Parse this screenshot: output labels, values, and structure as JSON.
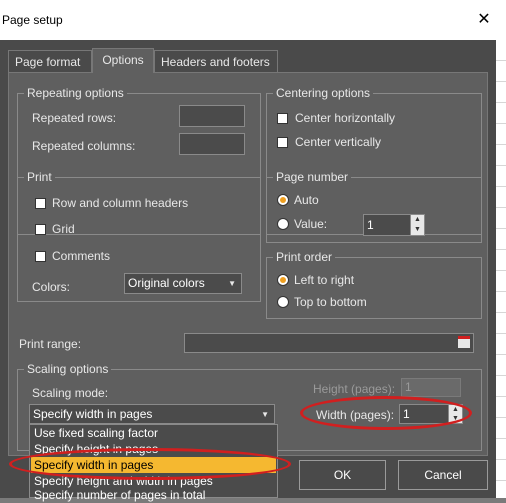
{
  "window": {
    "title": "Page setup",
    "close_glyph": "✕"
  },
  "tabs": [
    {
      "label": "Page format"
    },
    {
      "label": "Options"
    },
    {
      "label": "Headers and footers"
    }
  ],
  "repeating": {
    "title": "Repeating options",
    "rows_label": "Repeated rows:",
    "rows_value": "",
    "columns_label": "Repeated columns:",
    "columns_value": ""
  },
  "centering": {
    "title": "Centering options",
    "horizontally": {
      "label": "Center horizontally",
      "checked": false
    },
    "vertically": {
      "label": "Center vertically",
      "checked": false
    }
  },
  "print": {
    "title": "Print",
    "row_col_headers": {
      "label": "Row and column headers",
      "checked": false
    },
    "grid": {
      "label": "Grid",
      "checked": false
    },
    "comments": {
      "label": "Comments",
      "checked": false
    },
    "colors_label": "Colors:",
    "colors_value": "Original colors"
  },
  "page_number": {
    "title": "Page number",
    "auto_label": "Auto",
    "value_label": "Value:",
    "value": "1",
    "selected": "auto"
  },
  "print_order": {
    "title": "Print order",
    "ltr_label": "Left to right",
    "ttb_label": "Top to bottom",
    "selected": "left-to-right"
  },
  "print_range": {
    "label": "Print range:",
    "value": ""
  },
  "scaling": {
    "title": "Scaling options",
    "mode_label": "Scaling mode:",
    "mode_value": "Specify width in pages",
    "height_label": "Height (pages):",
    "height_value": "1",
    "width_label": "Width (pages):",
    "width_value": "1",
    "options": [
      "Use fixed scaling factor",
      "Specify height in pages",
      "Specify width in pages",
      "Specify height and width in pages",
      "Specify number of pages in total"
    ],
    "selected_index": 2
  },
  "buttons": {
    "ok": "OK",
    "cancel": "Cancel"
  },
  "colors": {
    "accent": "#f0a020",
    "selection": "#f5b830",
    "annotation": "#d11f1f"
  }
}
